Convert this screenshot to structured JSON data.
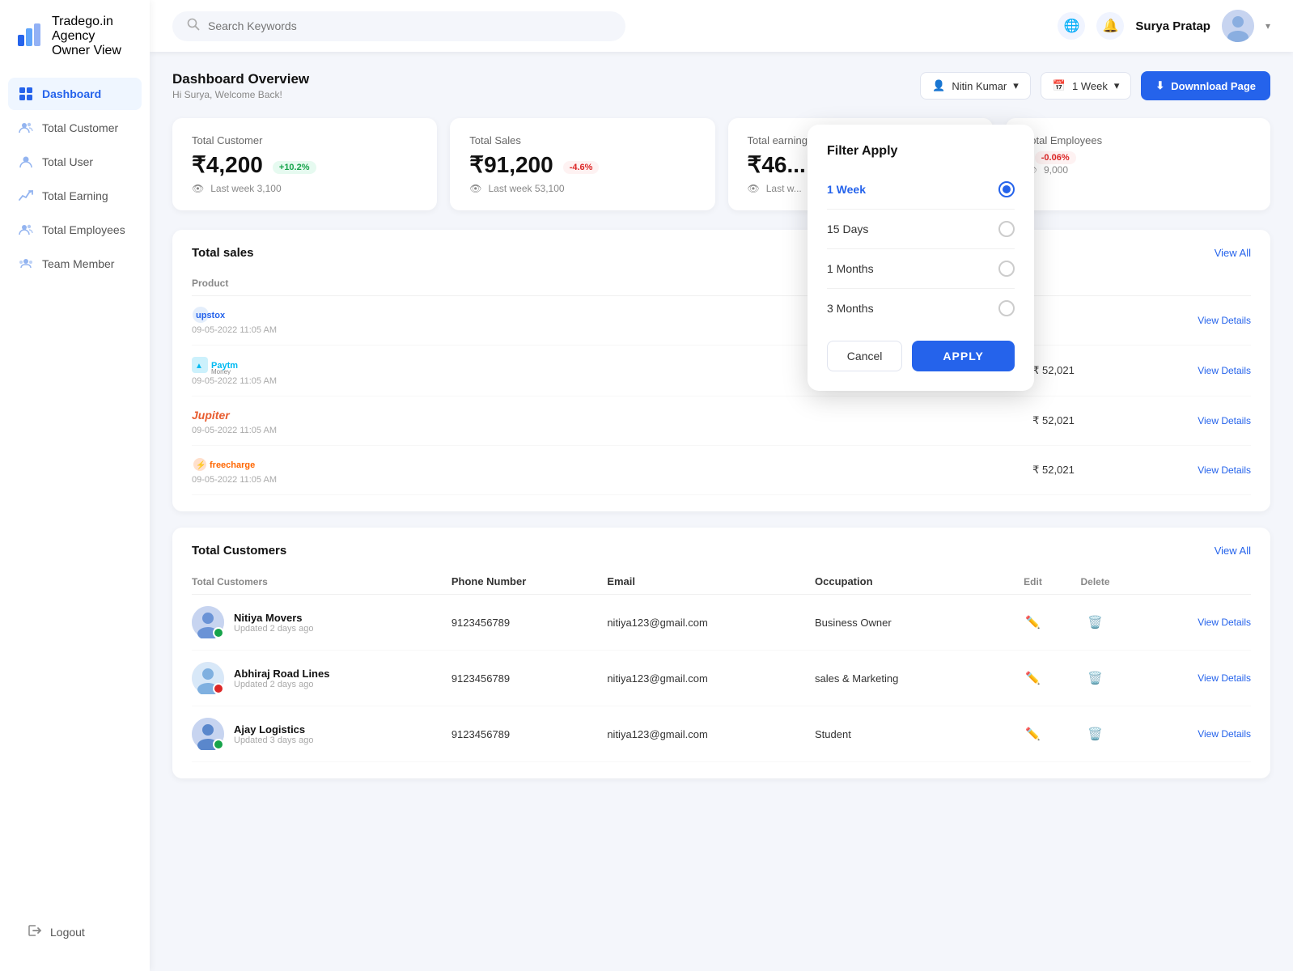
{
  "app": {
    "brand": "Tradego.in",
    "sub": "Agency Owner View",
    "logo_icon": "📊"
  },
  "sidebar": {
    "items": [
      {
        "id": "dashboard",
        "label": "Dashboard",
        "icon": "⊞",
        "active": true
      },
      {
        "id": "total-customer",
        "label": "Total Customer",
        "icon": "👥"
      },
      {
        "id": "total-user",
        "label": "Total User",
        "icon": "👤"
      },
      {
        "id": "total-earning",
        "label": "Total Earning",
        "icon": "📈"
      },
      {
        "id": "total-employees",
        "label": "Total Employees",
        "icon": "👨‍💼"
      },
      {
        "id": "team-member",
        "label": "Team Member",
        "icon": "🤝"
      }
    ],
    "logout_label": "Logout"
  },
  "topbar": {
    "search_placeholder": "Search Keywords",
    "user_name": "Surya Pratap",
    "avatar_icon": "👨"
  },
  "dashboard": {
    "title": "Dashboard Overview",
    "subtitle": "Hi Surya, Welcome Back!",
    "filter_user": "Nitin Kumar",
    "filter_week": "1 Week",
    "download_label": "Downnload Page"
  },
  "stats": [
    {
      "label": "Total Customer",
      "value": "₹4,200",
      "badge": "+10.2%",
      "badge_type": "pos",
      "footer": "Last week 3,100"
    },
    {
      "label": "Total Sales",
      "value": "₹91,200",
      "badge": "-4.6%",
      "badge_type": "neg",
      "footer": "Last week 53,100"
    },
    {
      "label": "Total earning",
      "value": "₹46...",
      "badge": "",
      "badge_type": "",
      "footer": "Last w..."
    },
    {
      "label": "Total Employees",
      "value": "",
      "badge": "-0.06%",
      "badge_type": "neg",
      "footer": "9,000"
    }
  ],
  "total_sales": {
    "title": "Total sales",
    "view_all": "View  All",
    "columns": [
      "Product",
      "",
      "",
      ""
    ],
    "rows": [
      {
        "product": "upstox",
        "product_color": "#4a90e2",
        "date": "09-05-2022  11:05 AM",
        "amount": "",
        "action": "View Details"
      },
      {
        "product": "PaytmMoney",
        "product_color": "#00baf2",
        "date": "09-05-2022  11:05 AM",
        "amount": "₹ 52,021",
        "action": "View Details"
      },
      {
        "product": "Jupiter",
        "product_color": "#e85d30",
        "date": "09-05-2022  11:05 AM",
        "amount": "₹ 52,021",
        "action": "View Details"
      },
      {
        "product": "freecharge",
        "product_color": "#ff6600",
        "date": "09-05-2022  11:05 AM",
        "amount": "₹ 52,021",
        "action": "View Details"
      }
    ]
  },
  "customers": {
    "title": "Total Customers",
    "view_all": "View  All",
    "columns": [
      "Total Customers",
      "Phone Number",
      "Email",
      "Occupation",
      "Edit",
      "Delete",
      ""
    ],
    "rows": [
      {
        "name": "Nitiya Movers",
        "updated": "Updated 2 days ago",
        "phone": "9123456789",
        "email": "nitiya123@gmail.com",
        "occupation": "Business Owner",
        "badge": "green",
        "avatar": "👨"
      },
      {
        "name": "Abhiraj Road Lines",
        "updated": "Updated 2 days ago",
        "phone": "9123456789",
        "email": "nitiya123@gmail.com",
        "occupation": "sales & Marketing",
        "badge": "red",
        "avatar": "👤"
      },
      {
        "name": "Ajay Logistics",
        "updated": "Updated 3 days ago",
        "phone": "9123456789",
        "email": "nitiya123@gmail.com",
        "occupation": "Student",
        "badge": "green",
        "avatar": "👨"
      }
    ]
  },
  "filter_modal": {
    "title": "Filter Apply",
    "options": [
      {
        "label": "1 Week",
        "selected": true
      },
      {
        "label": "15 Days",
        "selected": false
      },
      {
        "label": "1 Months",
        "selected": false
      },
      {
        "label": "3 Months",
        "selected": false
      }
    ],
    "cancel_label": "Cancel",
    "apply_label": "APPLY"
  }
}
